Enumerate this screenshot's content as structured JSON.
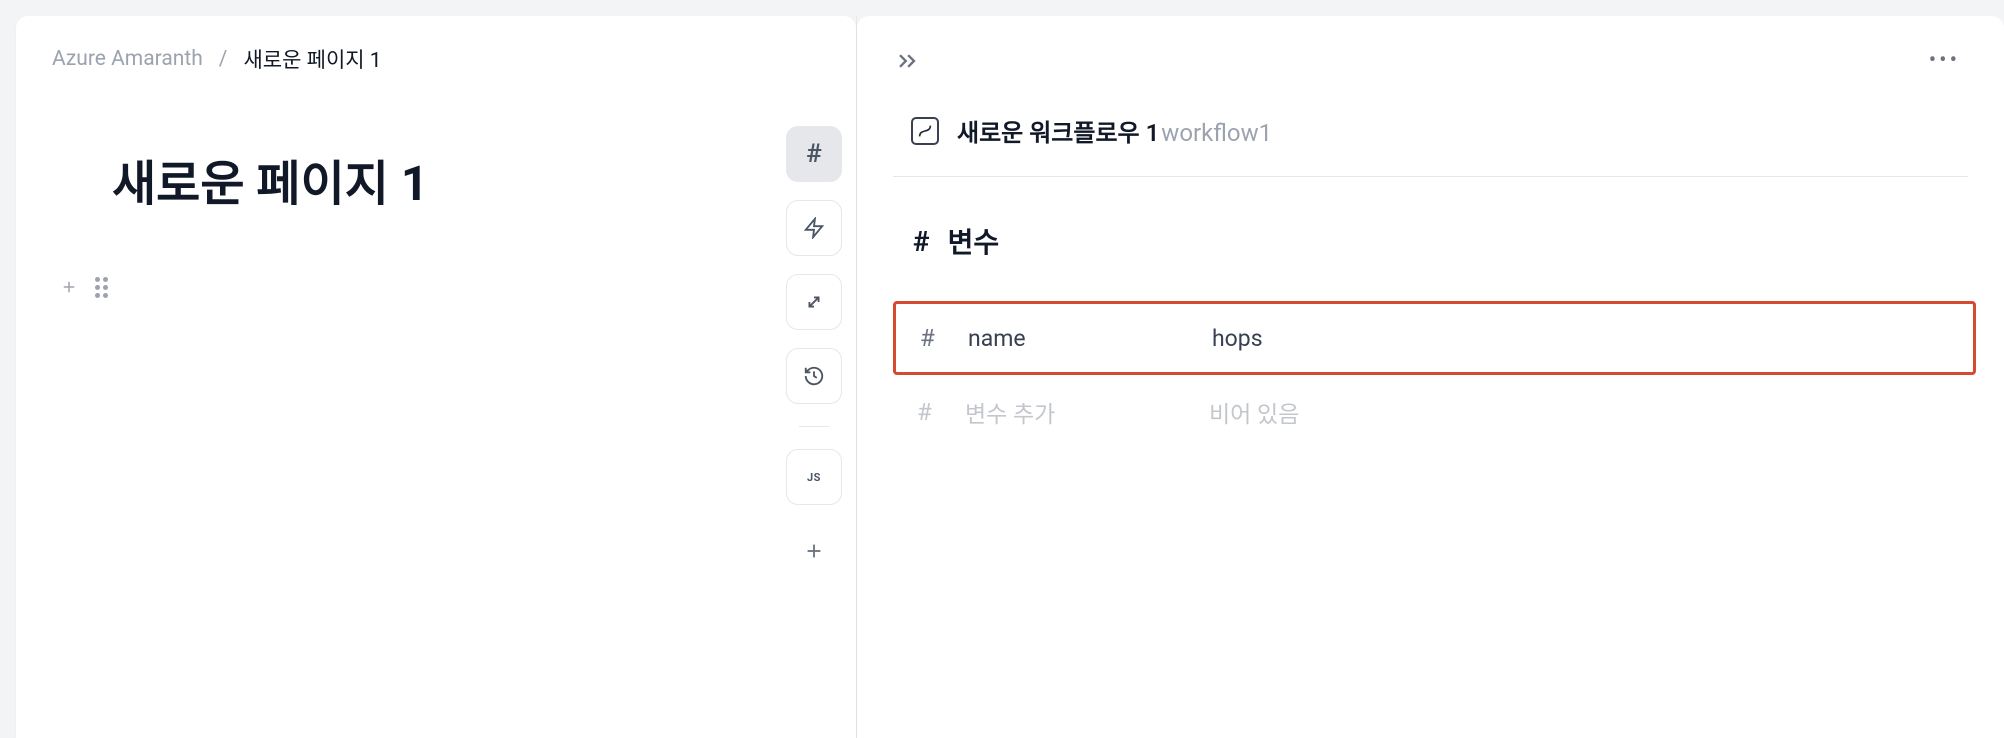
{
  "breadcrumb": {
    "workspace": "Azure Amaranth",
    "separator": "/",
    "page": "새로운 페이지 1"
  },
  "page_title": "새로운 페이지 1",
  "toolbar": {
    "js_label": "JS"
  },
  "workflow": {
    "title": "새로운 워크플로우 1",
    "id": "workflow1"
  },
  "variables_section": {
    "title": "변수",
    "rows": [
      {
        "name": "name",
        "value": "hops",
        "placeholder": false,
        "highlighted": true
      },
      {
        "name": "변수 추가",
        "value": "비어 있음",
        "placeholder": true,
        "highlighted": false
      }
    ]
  }
}
